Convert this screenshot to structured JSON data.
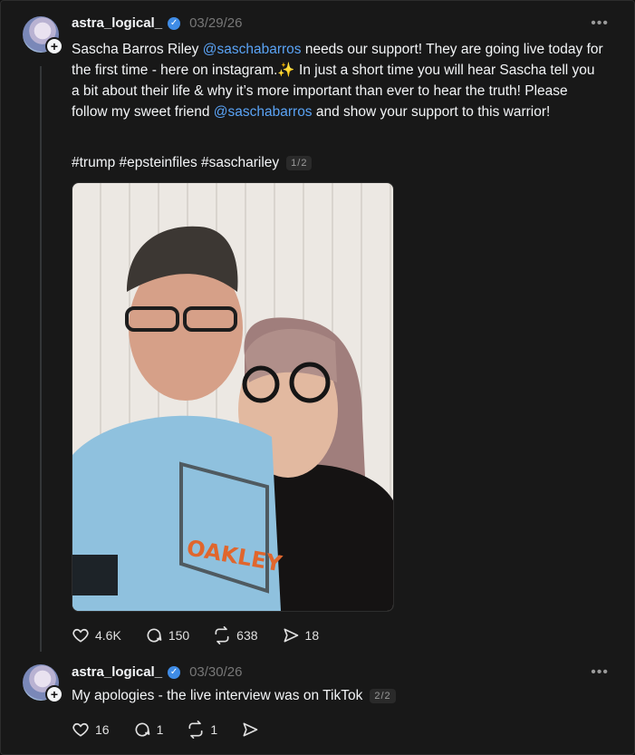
{
  "posts": [
    {
      "username": "astra_logical_",
      "date": "03/29/26",
      "text_parts": [
        "Sascha Barros Riley ",
        "@saschabarros",
        " needs our support! They are going live today for the first time - here on instagram.✨ In just a short time you will hear Sascha tell you a bit about their life & why it’s more important than ever to hear the truth! Please follow my sweet friend ",
        "@saschabarros",
        " and show your support to this warrior!"
      ],
      "hashtags": "#trump #epsteinfiles #saschariley",
      "pager": "1/2",
      "likes": "4.6K",
      "comments": "150",
      "reposts": "638",
      "shares": "18"
    },
    {
      "username": "astra_logical_",
      "date": "03/30/26",
      "text": "My apologies - the live interview was on TikTok",
      "pager": "2/2",
      "likes": "16",
      "comments": "1",
      "reposts": "1",
      "shares": ""
    }
  ],
  "icons": {
    "more": "more-options-icon",
    "verified": "verified-badge-icon",
    "like": "heart-icon",
    "comment": "comment-icon",
    "repost": "repost-icon",
    "share": "share-icon",
    "follow": "plus-icon"
  },
  "colors": {
    "accent_link": "#5aa3f5",
    "verified": "#3f8ce6",
    "background": "#181818"
  }
}
